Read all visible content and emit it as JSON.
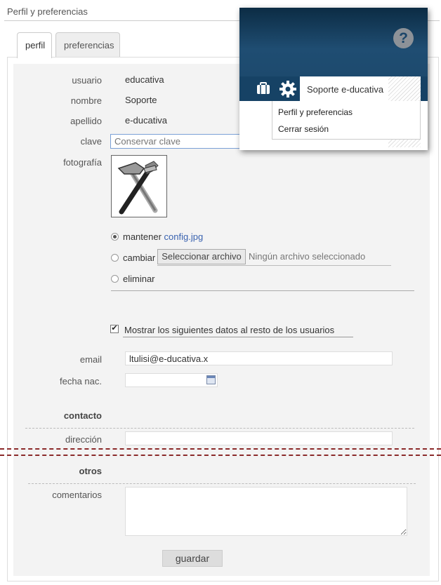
{
  "page": {
    "title": "Perfil y preferencias"
  },
  "tabs": [
    {
      "label": "perfil",
      "active": true
    },
    {
      "label": "preferencias",
      "active": false
    }
  ],
  "form": {
    "usuario_label": "usuario",
    "usuario_value": "educativa",
    "nombre_label": "nombre",
    "nombre_value": "Soporte",
    "apellido_label": "apellido",
    "apellido_value": "e-ducativa",
    "clave_label": "clave",
    "clave_placeholder": "Conservar clave",
    "foto_label": "fotografía",
    "photo_icon": "tools-icon",
    "keep_label": "mantener",
    "keep_file": "config.jpg",
    "change_label": "cambiar",
    "file_button": "Seleccionar archivo",
    "file_status": "Ningún archivo seleccionado",
    "delete_label": "eliminar",
    "photo_option_selected": "mantener",
    "show_data_label": "Mostrar los siguientes datos al resto de los usuarios",
    "show_data_checked": true,
    "email_label": "email",
    "email_value": "ltulisi@e-ducativa.x",
    "fecha_label": "fecha nac.",
    "fecha_value": "",
    "contacto_section": "contacto",
    "direccion_label": "dirección",
    "direccion_value": "",
    "otros_section": "otros",
    "comentarios_label": "comentarios",
    "comentarios_value": "",
    "save_label": "guardar"
  },
  "overlay": {
    "help_glyph": "?",
    "user_name": "Soporte e-ducativa",
    "menu": [
      "Perfil y preferencias",
      "Cerrar sesión"
    ],
    "icons": [
      "briefcase-icon",
      "gear-icon",
      "help-icon"
    ]
  },
  "colors": {
    "header_dark": "#0c2c44",
    "header_bar": "#164265",
    "link": "#3a63b0",
    "tear_line": "#8b2a2a"
  }
}
